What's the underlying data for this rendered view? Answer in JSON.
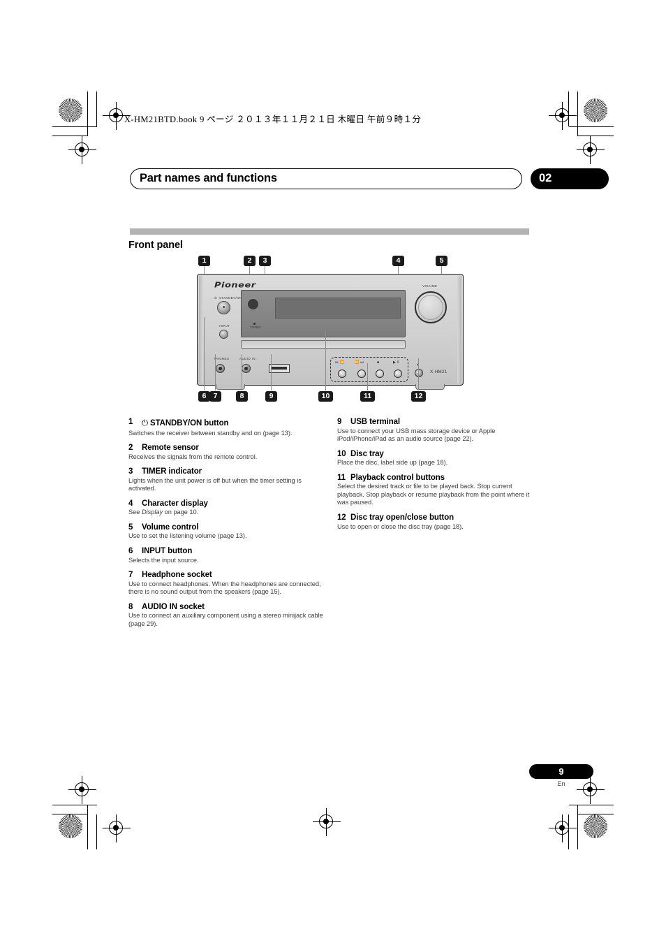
{
  "book_header": "X-HM21BTD.book   9 ページ   ２０１３年１１月２１日   木曜日   午前９時１分",
  "chapter": {
    "title": "Part names and functions",
    "number": "02"
  },
  "section": {
    "heading": "Front panel"
  },
  "figure": {
    "brand": "Pioneer",
    "model": "X-HM21",
    "panel_labels": {
      "standby": "STANDBY/ON",
      "input": "INPUT",
      "timer": "TIMER",
      "phones": "PHONES",
      "audio_in": "AUDIO IN",
      "volume": "VOLUME",
      "eject": "▲"
    },
    "playback_symbols": [
      "⏮ ⏪",
      "⏩ ⏭",
      "■",
      "▶ ‖"
    ],
    "callouts_top": [
      "1",
      "2",
      "3",
      "4",
      "5"
    ],
    "callouts_bottom": [
      "6",
      "7",
      "8",
      "9",
      "10",
      "11",
      "12"
    ]
  },
  "parts": {
    "left": [
      {
        "num": "1",
        "glyph": "⏻",
        "title": "STANDBY/ON button",
        "body": "Switches the receiver between standby and on (page 13)."
      },
      {
        "num": "2",
        "glyph": "",
        "title": "Remote sensor",
        "body": "Receives the signals from the remote control."
      },
      {
        "num": "3",
        "glyph": "",
        "title": "TIMER indicator",
        "body": "Lights when the unit power is off but when the timer setting is activated."
      },
      {
        "num": "4",
        "glyph": "",
        "title": "Character display",
        "body_pre": "See ",
        "body_italic": "Display",
        "body_post": " on page 10."
      },
      {
        "num": "5",
        "glyph": "",
        "title": "Volume control",
        "body": "Use to set the listening volume (page 13)."
      },
      {
        "num": "6",
        "glyph": "",
        "title": "INPUT button",
        "body": "Selects the input source."
      },
      {
        "num": "7",
        "glyph": "",
        "title": "Headphone socket",
        "body": "Use to connect headphones. When the headphones are connected, there is no sound output from the speakers (page 15)."
      },
      {
        "num": "8",
        "glyph": "",
        "title": "AUDIO IN socket",
        "body": "Use to connect an auxiliary component using a stereo minijack cable (page 29)."
      }
    ],
    "right": [
      {
        "num": "9",
        "glyph": "",
        "title": "USB terminal",
        "body": "Use to connect your USB mass storage device or Apple iPod/iPhone/iPad as an audio source (page 22)."
      },
      {
        "num": "10",
        "glyph": "",
        "title": "Disc tray",
        "body": "Place the disc, label side up (page 18)."
      },
      {
        "num": "11",
        "glyph": "",
        "title": "Playback control buttons",
        "body": "Select the desired track or file to be played back. Stop current playback. Stop playback or resume playback from the point where it was paused."
      },
      {
        "num": "12",
        "glyph": "",
        "title": "Disc tray open/close button",
        "body": "Use to open or close the disc tray (page 18)."
      }
    ]
  },
  "footer": {
    "page": "9",
    "lang": "En"
  }
}
